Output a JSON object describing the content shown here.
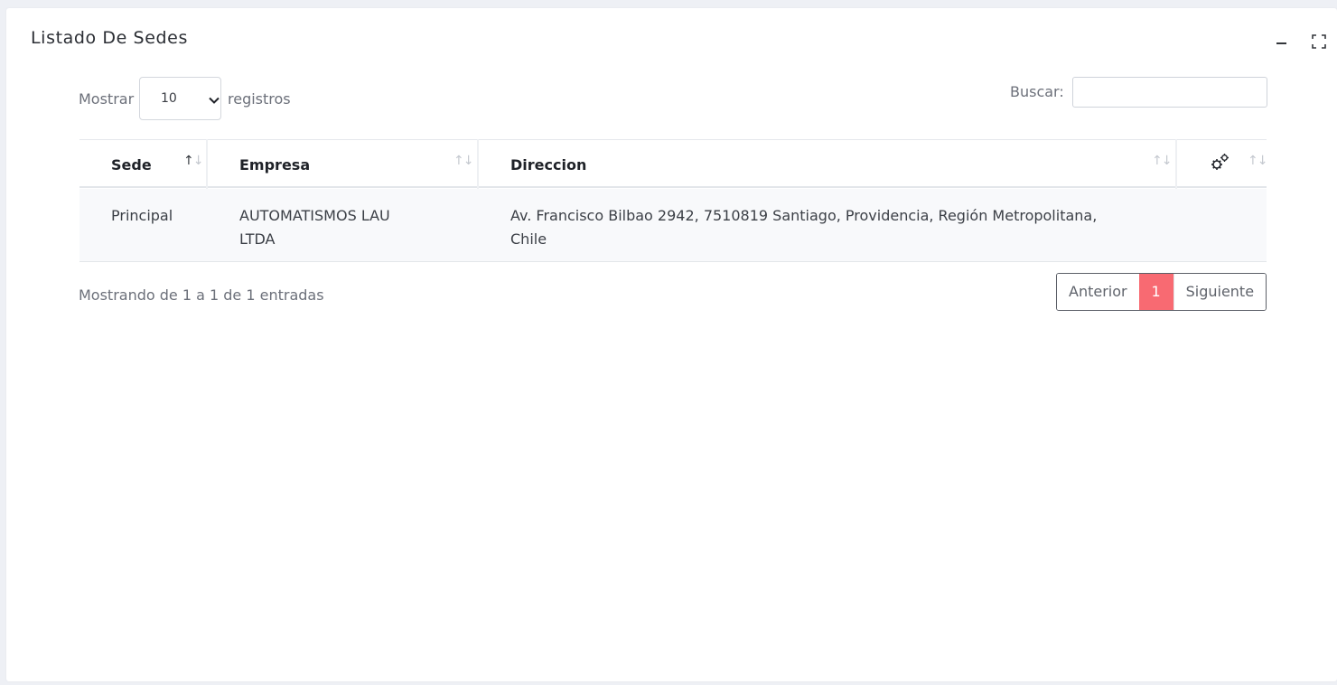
{
  "card": {
    "title": "Listado De Sedes"
  },
  "length_control": {
    "prefix": "Mostrar",
    "selected": "10",
    "suffix": "registros"
  },
  "search": {
    "label": "Buscar:",
    "value": "",
    "placeholder": ""
  },
  "table": {
    "columns": [
      {
        "label": "Sede",
        "sort": "asc"
      },
      {
        "label": "Empresa",
        "sort": "none"
      },
      {
        "label": "Direccion",
        "sort": "none"
      },
      {
        "label": "",
        "icon": "gears-icon",
        "sort": "none"
      }
    ],
    "rows": [
      {
        "sede": "Principal",
        "empresa": "AUTOMATISMOS LAU LTDA",
        "direccion": "Av. Francisco Bilbao 2942, 7510819 Santiago, Providencia, Región Metropolitana, Chile",
        "acciones": ""
      }
    ]
  },
  "footer": {
    "info": "Mostrando de 1 a 1 de 1 entradas",
    "pagination": {
      "previous": "Anterior",
      "current_page": "1",
      "next": "Siguiente"
    }
  },
  "colors": {
    "accent": "#f86a72",
    "background": "#eef0f5",
    "card": "#ffffff",
    "row_stripe": "#f8f9fb"
  }
}
